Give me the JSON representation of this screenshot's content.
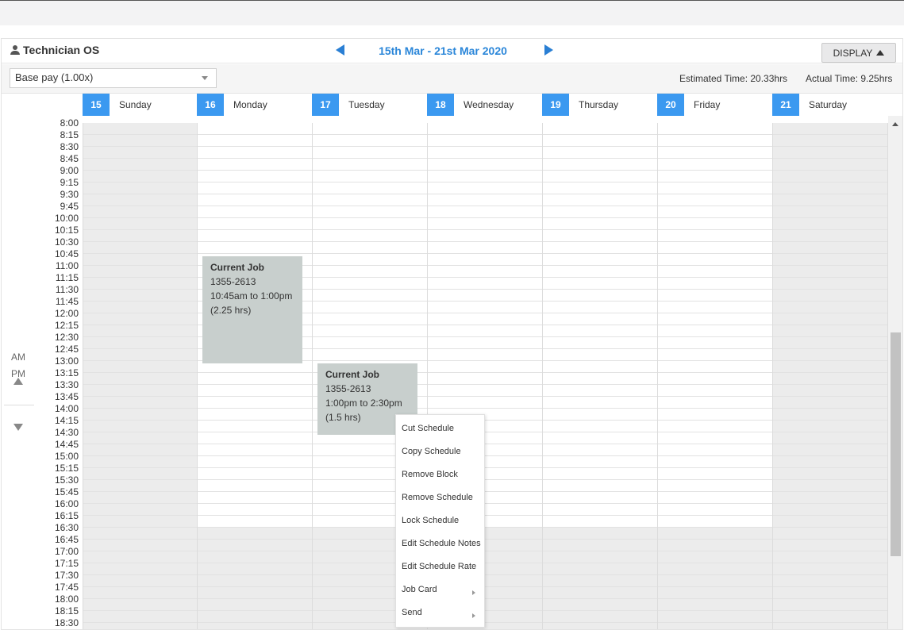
{
  "header": {
    "technician": "Technician OS",
    "date_range": "15th Mar - 21st Mar 2020",
    "display_label": "DISPLAY"
  },
  "toolbar": {
    "pay_rate_selected": "Base pay (1.00x)",
    "estimated_time": "Estimated Time: 20.33hrs",
    "actual_time": "Actual Time: 9.25hrs"
  },
  "days": [
    {
      "num": "15",
      "name": "Sunday"
    },
    {
      "num": "16",
      "name": "Monday"
    },
    {
      "num": "17",
      "name": "Tuesday"
    },
    {
      "num": "18",
      "name": "Wednesday"
    },
    {
      "num": "19",
      "name": "Thursday"
    },
    {
      "num": "20",
      "name": "Friday"
    },
    {
      "num": "21",
      "name": "Saturday"
    }
  ],
  "times": [
    "8:00",
    "8:15",
    "8:30",
    "8:45",
    "9:00",
    "9:15",
    "9:30",
    "9:45",
    "10:00",
    "10:15",
    "10:30",
    "10:45",
    "11:00",
    "11:15",
    "11:30",
    "11:45",
    "12:00",
    "12:15",
    "12:30",
    "12:45",
    "13:00",
    "13:15",
    "13:30",
    "13:45",
    "14:00",
    "14:15",
    "14:30",
    "14:45",
    "15:00",
    "15:15",
    "15:30",
    "15:45",
    "16:00",
    "16:15",
    "16:30",
    "16:45",
    "17:00",
    "17:15",
    "17:30",
    "17:45",
    "18:00",
    "18:15",
    "18:30"
  ],
  "ampm": {
    "am": "AM",
    "pm": "PM"
  },
  "jobs": [
    {
      "title": "Current Job",
      "number": "1355-2613",
      "time_range": "10:45am to 1:00pm",
      "duration": "(2.25 hrs)"
    },
    {
      "title": "Current Job",
      "number": "1355-2613",
      "time_range": "1:00pm to 2:30pm",
      "duration": "(1.5 hrs)"
    }
  ],
  "context_menu": [
    {
      "label": "Cut Schedule",
      "submenu": false
    },
    {
      "label": "Copy Schedule",
      "submenu": false
    },
    {
      "label": "Remove Block",
      "submenu": false
    },
    {
      "label": "Remove Schedule",
      "submenu": false
    },
    {
      "label": "Lock Schedule",
      "submenu": false
    },
    {
      "label": "Edit Schedule Notes",
      "submenu": false
    },
    {
      "label": "Edit Schedule Rate",
      "submenu": false
    },
    {
      "label": "Job Card",
      "submenu": true
    },
    {
      "label": "Send",
      "submenu": true
    }
  ],
  "colors": {
    "accent": "#3b99f0",
    "date_text": "#2a86d9",
    "job_block": "#c8cfcd",
    "unavailable": "#ececec"
  }
}
